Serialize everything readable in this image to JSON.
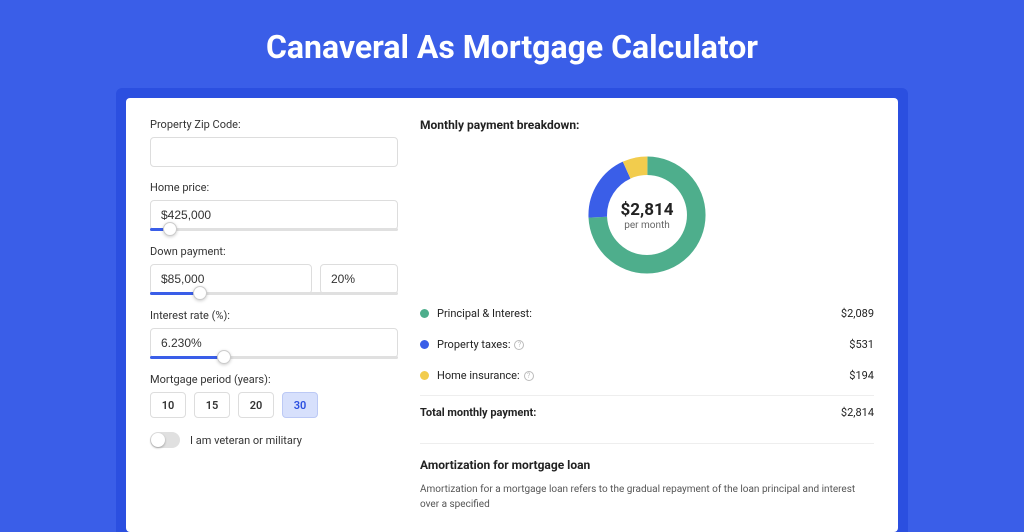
{
  "title": "Canaveral As Mortgage Calculator",
  "form": {
    "zip_label": "Property Zip Code:",
    "zip_value": "",
    "home_price_label": "Home price:",
    "home_price_value": "$425,000",
    "home_price_slider_pct": 8,
    "down_payment_label": "Down payment:",
    "down_payment_value": "$85,000",
    "down_payment_pct": "20%",
    "down_payment_slider_pct": 20,
    "interest_label": "Interest rate (%):",
    "interest_value": "6.230%",
    "interest_slider_pct": 30,
    "period_label": "Mortgage period (years):",
    "periods": [
      "10",
      "15",
      "20",
      "30"
    ],
    "period_active": "30",
    "veteran_label": "I am veteran or military"
  },
  "breakdown": {
    "title": "Monthly payment breakdown:",
    "amount": "$2,814",
    "per": "per month",
    "items": [
      {
        "label": "Principal & Interest:",
        "value": "$2,089",
        "color": "#4eae8c",
        "info": false
      },
      {
        "label": "Property taxes:",
        "value": "$531",
        "color": "#3a5ee8",
        "info": true
      },
      {
        "label": "Home insurance:",
        "value": "$194",
        "color": "#f2cc4d",
        "info": true
      }
    ],
    "total_label": "Total monthly payment:",
    "total_value": "$2,814"
  },
  "amortization": {
    "title": "Amortization for mortgage loan",
    "text": "Amortization for a mortgage loan refers to the gradual repayment of the loan principal and interest over a specified"
  },
  "chart_data": {
    "type": "pie",
    "title": "Monthly payment breakdown",
    "series": [
      {
        "name": "Principal & Interest",
        "value": 2089,
        "color": "#4eae8c"
      },
      {
        "name": "Property taxes",
        "value": 531,
        "color": "#3a5ee8"
      },
      {
        "name": "Home insurance",
        "value": 194,
        "color": "#f2cc4d"
      }
    ],
    "total": 2814,
    "center_label": "$2,814 per month"
  }
}
